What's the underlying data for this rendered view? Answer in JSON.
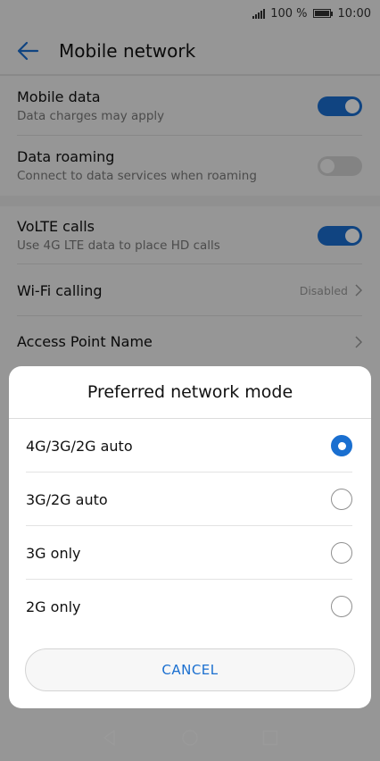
{
  "status_bar": {
    "battery_pct": "100 %",
    "time": "10:00"
  },
  "app_bar": {
    "title": "Mobile network"
  },
  "settings": [
    {
      "title": "Mobile data",
      "subtitle": "Data charges may apply",
      "control": "toggle",
      "on": true
    },
    {
      "title": "Data roaming",
      "subtitle": "Connect to data services when roaming",
      "control": "toggle",
      "on": false
    },
    {
      "title": "VoLTE calls",
      "subtitle": "Use 4G LTE data to place HD calls",
      "control": "toggle",
      "on": true
    },
    {
      "title": "Wi-Fi calling",
      "value": "Disabled",
      "control": "chevron"
    },
    {
      "title": "Access Point Name",
      "control": "chevron"
    }
  ],
  "dialog": {
    "title": "Preferred network mode",
    "options": [
      {
        "label": "4G/3G/2G auto",
        "selected": true
      },
      {
        "label": "3G/2G auto",
        "selected": false
      },
      {
        "label": "3G only",
        "selected": false
      },
      {
        "label": "2G only",
        "selected": false
      }
    ],
    "cancel_label": "CANCEL"
  },
  "nav_bar": {
    "icons": [
      "back-icon",
      "home-icon",
      "recents-icon"
    ]
  },
  "colors": {
    "accent": "#1a6fd0",
    "toggle_off": "#d3d3d3"
  }
}
